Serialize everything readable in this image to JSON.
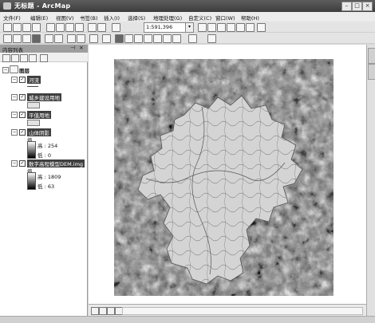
{
  "window": {
    "title": "无标题 - ArcMap"
  },
  "menu": [
    "文件(F)",
    "编辑(E)",
    "视图(V)",
    "书签(B)",
    "插入(I)",
    "选择(S)",
    "地理处理(G)",
    "自定义(C)",
    "窗口(W)",
    "帮助(H)"
  ],
  "toolbar": {
    "scale_value": "1:591,396"
  },
  "toc": {
    "title": "内容列表",
    "layers_label": "图层",
    "layers": [
      {
        "name": "河流"
      },
      {
        "name": "城乡建设用地"
      },
      {
        "name": "平值用地"
      },
      {
        "name": "山体阴影",
        "value_label": "值",
        "high_label": "高 : 254",
        "low_label": "低 : 0"
      },
      {
        "name": "数字高程模型DEM.img",
        "value_label": "值",
        "high_label": "高 : 1809",
        "low_label": "低 : 63"
      }
    ]
  },
  "icons": [
    "pin-icon",
    "close-icon",
    "minimize-icon",
    "maximize-icon",
    "zoom-in-icon",
    "zoom-out-icon",
    "pan-icon",
    "globe-icon",
    "identify-icon"
  ],
  "colors": {
    "titlebar": "#4a4a4a",
    "layer_label_bg": "#3f3f3f",
    "toc_header": "#9e9e9e"
  }
}
